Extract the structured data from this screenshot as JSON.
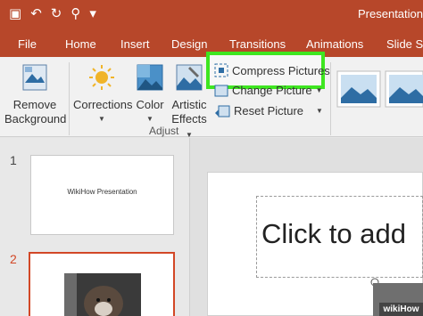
{
  "title_bar": {
    "doc_title": "Presentation.p",
    "qat_icons": [
      "save-icon",
      "undo-icon",
      "redo-icon",
      "present-icon",
      "customize-icon"
    ],
    "qat_glyphs": [
      "▣",
      "↶",
      "↻",
      "⚲",
      "▾"
    ]
  },
  "tabs": [
    "File",
    "Home",
    "Insert",
    "Design",
    "Transitions",
    "Animations",
    "Slide Sh"
  ],
  "ribbon": {
    "remove_background": {
      "line1": "Remove",
      "line2": "Background"
    },
    "corrections": "Corrections",
    "color": "Color",
    "artistic_effects": {
      "line1": "Artistic",
      "line2": "Effects"
    },
    "compress_pictures": "Compress Pictures",
    "change_picture": "Change Picture",
    "reset_picture": "Reset Picture",
    "group_label": "Adjust"
  },
  "slides": [
    {
      "number": "1",
      "caption": "WikiHow Presentation"
    },
    {
      "number": "2",
      "caption": ""
    }
  ],
  "editor": {
    "placeholder": "Click to add"
  },
  "watermark": "wikiHow",
  "colors": {
    "accent": "#b7472a",
    "highlight": "#3ee620",
    "selected_slide_number": "#d24726"
  }
}
